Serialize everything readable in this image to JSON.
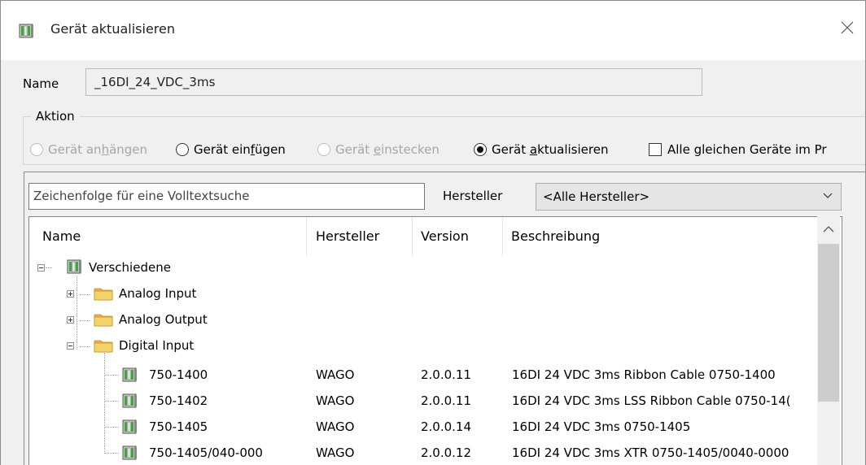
{
  "window": {
    "title": "Gerät aktualisieren",
    "icon": "device-module-icon",
    "close_icon": "close-icon"
  },
  "name_field": {
    "label": "Name",
    "value": "_16DI_24_VDC_3ms"
  },
  "aktion": {
    "legend": "Aktion",
    "options": [
      {
        "pre": "Gerät an",
        "acc": "h",
        "post": "ängen",
        "state": "unselected",
        "enabled": false
      },
      {
        "pre": "Gerät ein",
        "acc": "f",
        "post": "ügen",
        "state": "unselected",
        "enabled": true
      },
      {
        "pre": "Gerät ",
        "acc": "e",
        "post": "instecken",
        "state": "unselected",
        "enabled": false
      },
      {
        "pre": "Gerät ",
        "acc": "a",
        "post": "ktualisieren",
        "state": "selected",
        "enabled": true
      }
    ],
    "checkbox": {
      "label": "Alle gleichen Geräte im Pr",
      "checked": false
    }
  },
  "search": {
    "placeholder": "Zeichenfolge für eine Volltextsuche"
  },
  "vendor_filter": {
    "label": "Hersteller",
    "selected": "<Alle Hersteller>"
  },
  "table": {
    "columns": [
      "Name",
      "Hersteller",
      "Version",
      "Beschreibung"
    ],
    "rows": [
      {
        "name": "Verschiedene",
        "kind": "device",
        "state": "expanded"
      },
      {
        "name": "Analog Input",
        "kind": "folder",
        "state": "collapsed"
      },
      {
        "name": "Analog Output",
        "kind": "folder",
        "state": "collapsed"
      },
      {
        "name": "Digital Input",
        "kind": "folder",
        "state": "expanded"
      },
      {
        "name": "750-1400",
        "hersteller": "WAGO",
        "version": "2.0.0.11",
        "beschreibung": "16DI 24 VDC 3ms Ribbon Cable  0750-1400"
      },
      {
        "name": "750-1402",
        "hersteller": "WAGO",
        "version": "2.0.0.11",
        "beschreibung": "16DI 24 VDC 3ms LSS Ribbon Cable  0750-14("
      },
      {
        "name": "750-1405",
        "hersteller": "WAGO",
        "version": "2.0.0.14",
        "beschreibung": "16DI 24 VDC 3ms  0750-1405"
      },
      {
        "name": "750-1405/040-000",
        "hersteller": "WAGO",
        "version": "2.0.0.12",
        "beschreibung": "16DI 24 VDC 3ms XTR  0750-1405/0040-0000"
      }
    ]
  },
  "colors": {
    "dialog_bg": "#f0f0f0",
    "folder": "#f3c74f",
    "device_green": "#3fa53f"
  }
}
